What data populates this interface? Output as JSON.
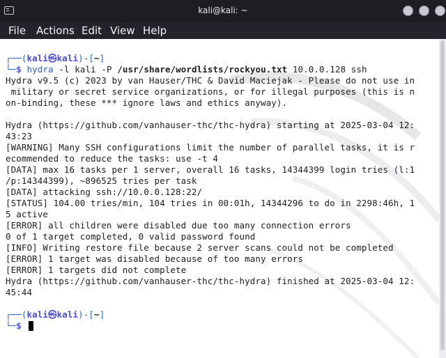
{
  "window": {
    "title": "kali@kali: ~"
  },
  "menu": [
    "File",
    "Actions",
    "Edit",
    "View",
    "Help"
  ],
  "prompt": {
    "open": "┌──(",
    "user": "kali",
    "at": "㉿",
    "host": "kali",
    "mid": ")-[",
    "dir": "~",
    "close": "]",
    "corner": "└─",
    "dollar": "$"
  },
  "command": {
    "tool": "hydra",
    "args1": " -l kali -P ",
    "wordlist": "/usr/share/wordlists/rockyou.txt",
    "args2": " 10.0.0.128 ssh"
  },
  "output": [
    "Hydra v9.5 (c) 2023 by van Hauser/THC & David Maciejak - Please do not use in",
    " military or secret service organizations, or for illegal purposes (this is n",
    "on-binding, these *** ignore laws and ethics anyway).",
    "",
    "Hydra (https://github.com/vanhauser-thc/thc-hydra) starting at 2025-03-04 12:",
    "43:23",
    "[WARNING] Many SSH configurations limit the number of parallel tasks, it is r",
    "ecommended to reduce the tasks: use -t 4",
    "[DATA] max 16 tasks per 1 server, overall 16 tasks, 14344399 login tries (l:1",
    "/p:14344399), ~896525 tries per task",
    "[DATA] attacking ssh://10.0.0.128:22/",
    "[STATUS] 104.00 tries/min, 104 tries in 00:01h, 14344296 to do in 2298:46h, 1",
    "5 active",
    "[ERROR] all children were disabled due too many connection errors",
    "0 of 1 target completed, 0 valid password found",
    "[INFO] Writing restore file because 2 server scans could not be completed",
    "[ERROR] 1 target was disabled because of too many errors",
    "[ERROR] 1 targets did not complete",
    "Hydra (https://github.com/vanhauser-thc/thc-hydra) finished at 2025-03-04 12:",
    "45:44"
  ]
}
